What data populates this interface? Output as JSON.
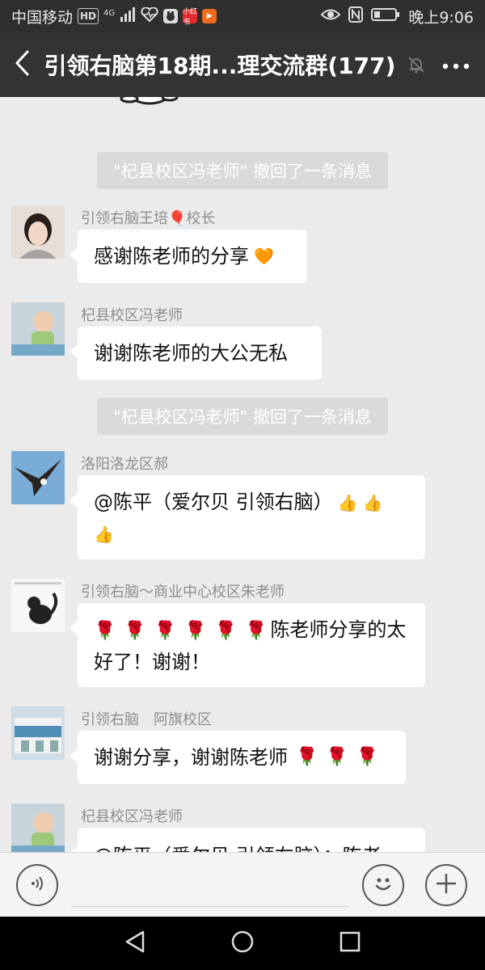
{
  "status_bar": {
    "carrier": "中国移动",
    "network": "4G",
    "badge_hd": "HD",
    "chips": [
      {
        "label": "",
        "color": "#ffffff"
      },
      {
        "label": "小红书",
        "color": "#e12b2b"
      },
      {
        "label": "▶",
        "color": "#f06d1e"
      }
    ],
    "time": "晚上9:06"
  },
  "header": {
    "title": "引领右脑第18期...理交流群(177)"
  },
  "chat": {
    "system_messages": [
      {
        "text": "\"杞县校区冯老师\" 撤回了一条消息"
      },
      {
        "text": "\"杞县校区冯老师\" 撤回了一条消息"
      }
    ],
    "messages": [
      {
        "sender": "引领右脑王培🎈校长",
        "text": "感谢陈老师的分享",
        "emoji": "🧡"
      },
      {
        "sender": "杞县校区冯老师",
        "text": "谢谢陈老师的大公无私"
      },
      {
        "sender": "洛阳洛龙区郝",
        "text_line1": "@陈平（爱尔贝 引领右脑）",
        "emoji": "👍"
      },
      {
        "sender": "引领右脑～商业中心校区朱老师",
        "rose": "🌹",
        "text_line1_tail": "陈老师分享的太",
        "text_line2": "好了！谢谢！"
      },
      {
        "sender": "引领右脑　阿旗校区",
        "text": "谢谢分享，谢谢陈老师",
        "rose": "🌹"
      },
      {
        "sender": "杞县校区冯老师",
        "text": "@陈平（爱尔贝 引领右脑）：陈老"
      }
    ]
  },
  "input_bar": {
    "voice_icon": "voice-icon",
    "emoji_icon": "emoji-icon",
    "plus_icon": "plus-icon"
  },
  "nav_bar": {
    "back": "triangle",
    "home": "circle",
    "recents": "square"
  }
}
